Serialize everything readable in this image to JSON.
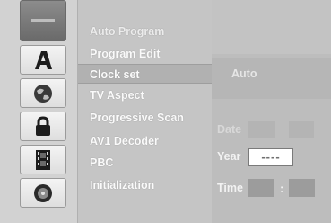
{
  "sidebar": {
    "icons": [
      {
        "name": "menu-bar-icon"
      },
      {
        "name": "letter-a-icon"
      },
      {
        "name": "globe-icon"
      },
      {
        "name": "padlock-icon"
      },
      {
        "name": "film-strip-icon"
      },
      {
        "name": "disc-icon"
      }
    ]
  },
  "menu": {
    "items": [
      {
        "label": "Auto Program"
      },
      {
        "label": "Program Edit"
      },
      {
        "label": "Clock set"
      },
      {
        "label": "TV Aspect"
      },
      {
        "label": "Progressive Scan"
      },
      {
        "label": "AV1 Decoder"
      },
      {
        "label": "PBC"
      },
      {
        "label": "Initialization"
      }
    ],
    "selected_index": 2
  },
  "clock_panel": {
    "mode_value": "Auto",
    "date_label": "Date",
    "year_label": "Year",
    "year_value": "----",
    "time_label": "Time",
    "time_separator": ":"
  }
}
